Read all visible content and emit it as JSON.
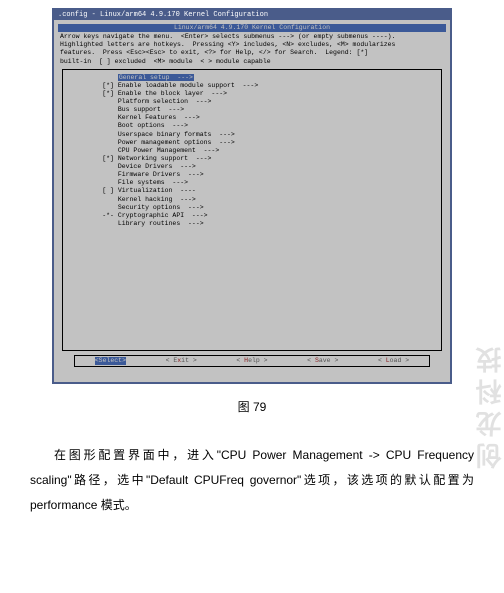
{
  "terminal": {
    "titlebar": ".config - Linux/arm64 4.9.170 Kernel Configuration",
    "header": "Linux/arm64 4.9.170 Kernel Configuration",
    "help": "Arrow keys navigate the menu.  <Enter> selects submenus ---> (or empty submenus ----).\nHighlighted letters are hotkeys.  Pressing <Y> includes, <N> excludes, <M> modularizes\nfeatures.  Press <Esc><Esc> to exit, <?> for Help, </> for Search.  Legend: [*]\nbuilt-in  [ ] excluded  <M> module  < > module capable",
    "items": [
      {
        "prefix": "    ",
        "label": "General setup  --->",
        "sel": true
      },
      {
        "prefix": "[*] ",
        "label": "Enable loadable module support  --->"
      },
      {
        "prefix": "[*] ",
        "label": "Enable the block layer  --->"
      },
      {
        "prefix": "    ",
        "label": "Platform selection  --->"
      },
      {
        "prefix": "    ",
        "label": "Bus support  --->"
      },
      {
        "prefix": "    ",
        "label": "Kernel Features  --->"
      },
      {
        "prefix": "    ",
        "label": "Boot options  --->"
      },
      {
        "prefix": "    ",
        "label": "Userspace binary formats  --->"
      },
      {
        "prefix": "    ",
        "label": "Power management options  --->"
      },
      {
        "prefix": "    ",
        "label": "CPU Power Management  --->"
      },
      {
        "prefix": "[*] ",
        "label": "Networking support  --->"
      },
      {
        "prefix": "    ",
        "label": "Device Drivers  --->"
      },
      {
        "prefix": "    ",
        "label": "Firmware Drivers  --->"
      },
      {
        "prefix": "    ",
        "label": "File systems  --->"
      },
      {
        "prefix": "[ ] ",
        "label": "Virtualization  ----"
      },
      {
        "prefix": "    ",
        "label": "Kernel hacking  --->"
      },
      {
        "prefix": "    ",
        "label": "Security options  --->"
      },
      {
        "prefix": "-*- ",
        "label": "Cryptographic API  --->"
      },
      {
        "prefix": "    ",
        "label": "Library routines  --->"
      }
    ],
    "buttons": {
      "select": "<Select>",
      "exit_l": "< E",
      "exit_h": "x",
      "exit_r": "it >",
      "help_l": "< ",
      "help_h": "H",
      "help_r": "elp >",
      "save_l": "< ",
      "save_h": "S",
      "save_r": "ave >",
      "load_l": "< ",
      "load_h": "L",
      "load_r": "oad >"
    }
  },
  "caption": "图 79",
  "paragraph": "在图形配置界面中，进入\"CPU Power Management -> CPU Frequency scaling\"路径，选中\"Default CPUFreq governor\"选项，该选项的默认配置为 performance 模式。",
  "watermark": "创龙科技"
}
